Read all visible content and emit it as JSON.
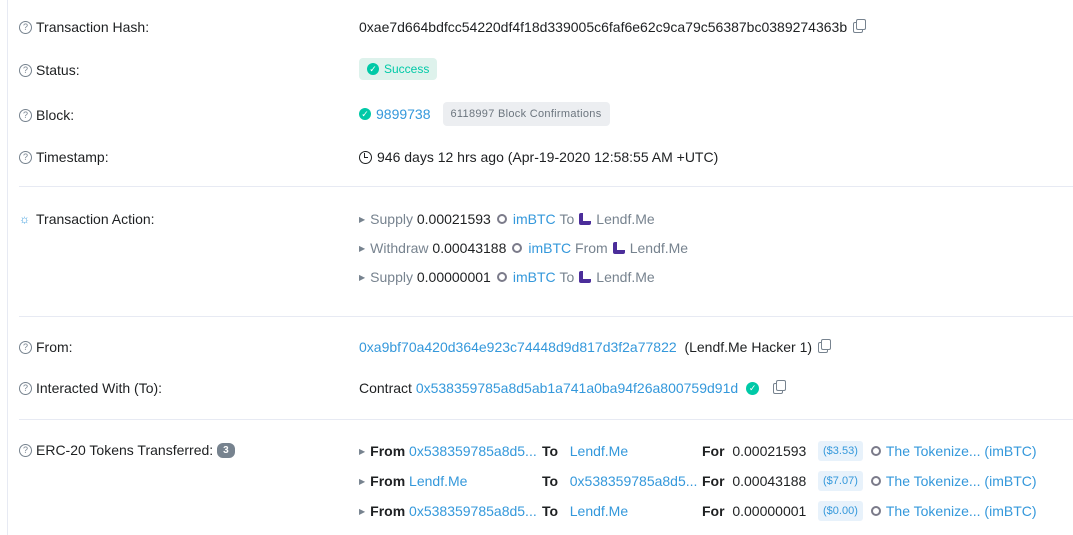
{
  "tx_hash": {
    "label": "Transaction Hash:",
    "value": "0xae7d664bdfcc54220df4f18d339005c6faf6e62c9ca79c56387bc0389274363b"
  },
  "status": {
    "label": "Status:",
    "value": "Success"
  },
  "block": {
    "label": "Block:",
    "number": "9899738",
    "confirmations": "6118997 Block Confirmations"
  },
  "timestamp": {
    "label": "Timestamp:",
    "value": "946 days 12 hrs ago (Apr-19-2020 12:58:55 AM +UTC)"
  },
  "tx_action": {
    "label": "Transaction Action:",
    "actions": [
      {
        "verb": "Supply",
        "amount": "0.00021593",
        "token": "imBTC",
        "prep": "To",
        "target": "Lendf.Me"
      },
      {
        "verb": "Withdraw",
        "amount": "0.00043188",
        "token": "imBTC",
        "prep": "From",
        "target": "Lendf.Me"
      },
      {
        "verb": "Supply",
        "amount": "0.00000001",
        "token": "imBTC",
        "prep": "To",
        "target": "Lendf.Me"
      }
    ]
  },
  "from": {
    "label": "From:",
    "address": "0xa9bf70a420d364e923c74448d9d817d3f2a77822",
    "tag": "(Lendf.Me Hacker 1)"
  },
  "to": {
    "label": "Interacted With (To):",
    "prefix": "Contract",
    "address": "0x538359785a8d5ab1a741a0ba94f26a800759d91d"
  },
  "erc20": {
    "label": "ERC-20 Tokens Transferred:",
    "count": "3",
    "transfers": [
      {
        "from_label": "From",
        "from": "0x538359785a8d5...",
        "to_label": "To",
        "to": "Lendf.Me",
        "for_label": "For",
        "amount": "0.00021593",
        "usd": "($3.53)",
        "token": "The Tokenize... (imBTC)"
      },
      {
        "from_label": "From",
        "from": "Lendf.Me",
        "to_label": "To",
        "to": "0x538359785a8d5...",
        "for_label": "For",
        "amount": "0.00043188",
        "usd": "($7.07)",
        "token": "The Tokenize... (imBTC)"
      },
      {
        "from_label": "From",
        "from": "0x538359785a8d5...",
        "to_label": "To",
        "to": "Lendf.Me",
        "for_label": "For",
        "amount": "0.00000001",
        "usd": "($0.00)",
        "token": "The Tokenize... (imBTC)"
      }
    ]
  }
}
